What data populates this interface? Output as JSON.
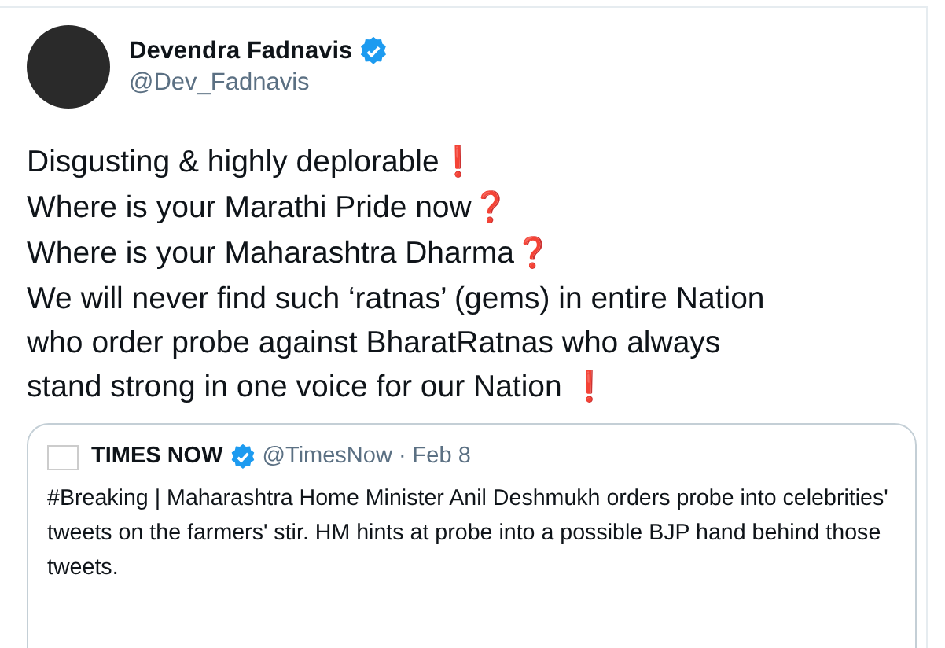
{
  "author": {
    "name": "Devendra Fadnavis",
    "verified": true,
    "handle": "@Dev_Fadnavis"
  },
  "tweet_lines": [
    {
      "text": "Disgusting & highly deplorable",
      "mark": "❗"
    },
    {
      "text": "Where is your Marathi Pride now",
      "mark": "❓"
    },
    {
      "text": "Where is your Maharashtra Dharma",
      "mark": "❓"
    },
    {
      "text": "We will never find such ‘ratnas’ (gems) in entire Nation"
    },
    {
      "text": "who order probe against BharatRatnas who always"
    },
    {
      "text": "stand strong in one voice for our Nation ",
      "mark": "❗"
    }
  ],
  "quoted_tweet": {
    "name": "TIMES NOW",
    "verified": true,
    "handle": "@TimesNow",
    "date": "· Feb 8",
    "text": "#Breaking | Maharashtra Home Minister Anil Deshmukh orders probe into celebrities' tweets on the farmers' stir. HM hints at probe into a possible BJP hand behind those tweets."
  }
}
